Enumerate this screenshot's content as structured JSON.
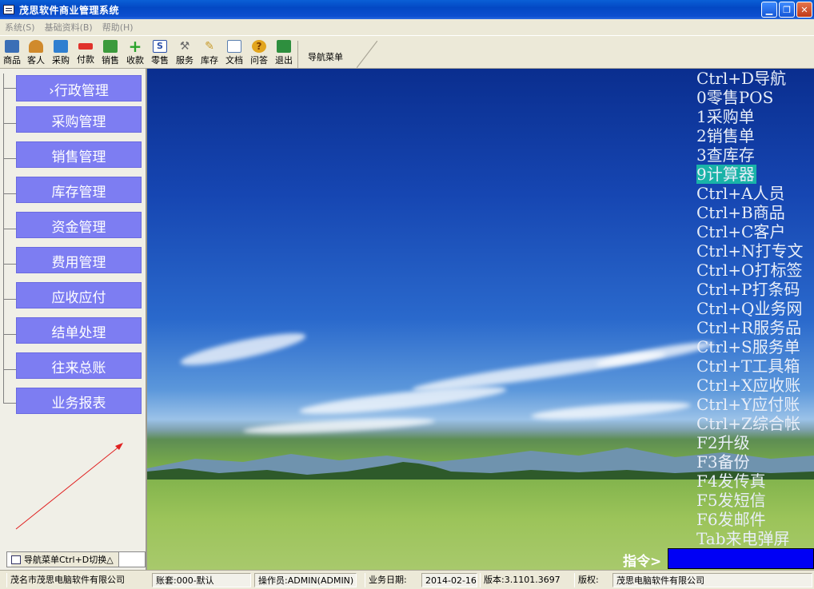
{
  "window": {
    "title": "茂思软件商业管理系统"
  },
  "menu": {
    "items": [
      "系统(S)",
      "基础资料(B)",
      "帮助(H)"
    ]
  },
  "toolbar": {
    "buttons": [
      {
        "label": "商品",
        "icon": "product-icon",
        "color": "#3B6FB6"
      },
      {
        "label": "客人",
        "icon": "people-icon",
        "color": "#D08A2C"
      },
      {
        "label": "采购",
        "icon": "purchase-icon",
        "color": "#2F7FD0"
      },
      {
        "label": "付款",
        "icon": "payment-icon",
        "color": "#E0322B"
      },
      {
        "label": "销售",
        "icon": "sales-icon",
        "color": "#3C9A3C"
      },
      {
        "label": "收款",
        "icon": "plus-icon",
        "color": "#2BA32B"
      },
      {
        "label": "零售",
        "icon": "retail-icon",
        "color": "#2A4FA8"
      },
      {
        "label": "服务",
        "icon": "tools-icon",
        "color": "#6B6B6B"
      },
      {
        "label": "库存",
        "icon": "inventory-icon",
        "color": "#C79A2A"
      },
      {
        "label": "文档",
        "icon": "document-icon",
        "color": "#5A7FB0"
      },
      {
        "label": "问答",
        "icon": "question-icon",
        "color": "#E2A51E"
      },
      {
        "label": "退出",
        "icon": "exit-icon",
        "color": "#2E8F3E"
      }
    ],
    "nav_tab": "导航菜单"
  },
  "sidebar": {
    "items": [
      "›行政管理",
      "采购管理",
      "销售管理",
      "库存管理",
      "资金管理",
      "费用管理",
      "应收应付",
      "结单处理",
      "往来总账",
      "业务报表"
    ],
    "bottom_tab": "导航菜单Ctrl+D切换△"
  },
  "shortcuts": [
    "Ctrl+D导航",
    "0零售POS",
    "1采购单",
    "2销售单",
    "3查库存",
    "9计算器",
    "Ctrl+A人员",
    "Ctrl+B商品",
    "Ctrl+C客户",
    "Ctrl+N打专文",
    "Ctrl+O打标签",
    "Ctrl+P打条码",
    "Ctrl+Q业务网",
    "Ctrl+R服务品",
    "Ctrl+S服务单",
    "Ctrl+T工具箱",
    "Ctrl+X应收账",
    "Ctrl+Y应付账",
    "Ctrl+Z综合帐",
    "F2升级",
    "F3备份",
    "F4发传真",
    "F5发短信",
    "F6发邮件",
    "Tab来电弹屏"
  ],
  "shortcut_highlight_index": 5,
  "command": {
    "label": "指令>",
    "value": ""
  },
  "status": {
    "company": "茂名市茂思电脑软件有限公司",
    "account": "账套:000-默认",
    "operator": "操作员:ADMIN(ADMIN)",
    "date_label": "业务日期:",
    "date": "2014-02-16",
    "version": "版本:3.1101.3697",
    "copyright_label": "版权:",
    "copyright": "茂思电脑软件有限公司"
  },
  "colors": {
    "nav_button": "#7D7DF2",
    "highlight": "#19B3A8",
    "command_input": "#0000F5"
  }
}
